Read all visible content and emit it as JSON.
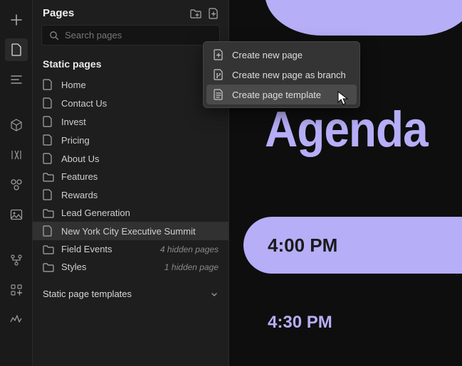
{
  "panel": {
    "title": "Pages",
    "search_placeholder": "Search pages",
    "static_section": "Static pages",
    "templates_section": "Static page templates"
  },
  "pages": [
    {
      "label": "Home",
      "icon": "file",
      "home": true
    },
    {
      "label": "Contact Us",
      "icon": "file"
    },
    {
      "label": "Invest",
      "icon": "file"
    },
    {
      "label": "Pricing",
      "icon": "file"
    },
    {
      "label": "About Us",
      "icon": "file"
    },
    {
      "label": "Features",
      "icon": "folder"
    },
    {
      "label": "Rewards",
      "icon": "file"
    },
    {
      "label": "Lead Generation",
      "icon": "folder"
    },
    {
      "label": "New York City Executive Summit",
      "icon": "file",
      "selected": true
    },
    {
      "label": "Field Events",
      "icon": "folder",
      "extra": "4 hidden pages"
    },
    {
      "label": "Styles",
      "icon": "folder",
      "extra": "1 hidden page"
    }
  ],
  "context_menu": [
    {
      "label": "Create new page"
    },
    {
      "label": "Create new page as branch"
    },
    {
      "label": "Create page template",
      "hovered": true
    }
  ],
  "canvas": {
    "title": "Agenda",
    "time1": "4:00 PM",
    "time2": "4:30 PM"
  }
}
